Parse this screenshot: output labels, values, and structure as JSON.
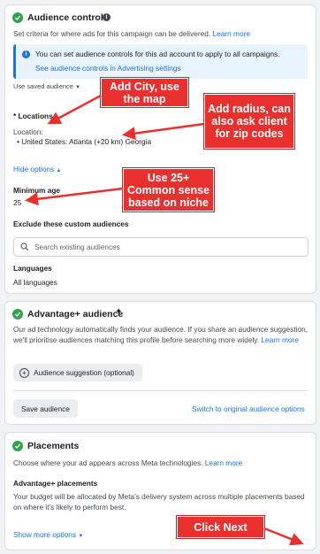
{
  "audience_controls": {
    "title": "Audience controls",
    "description": "Set criteria for where ads for this campaign can be delivered.",
    "learn_more": "Learn more",
    "info_text": "You can set audience controls for this ad account to apply to all campaigns.",
    "info_link": "See audience controls in Advertising settings",
    "saved_audience": "Use saved audience",
    "locations_label": "* Locations",
    "location_sub": "Location:",
    "location_value": "United States: Atlanta (+20 km) Georgia",
    "hide_options": "Hide options",
    "min_age_label": "Minimum age",
    "min_age_value": "25",
    "exclude_label": "Exclude these custom audiences",
    "search_placeholder": "Search existing audiences",
    "languages_label": "Languages",
    "languages_value": "All languages"
  },
  "advantage": {
    "title": "Advantage+ audience",
    "description": "Our ad technology automatically finds your audience. If you share an audience suggestion, we'll prioritise audiences matching this profile before searching more widely.",
    "learn_more": "Learn more",
    "suggestion_button": "Audience suggestion (optional)",
    "save_button": "Save audience",
    "switch_link": "Switch to original audience options"
  },
  "placements": {
    "title": "Placements",
    "description": "Choose where your ad appears across Meta technologies.",
    "learn_more": "Learn more",
    "sub_title": "Advantage+ placements",
    "sub_text": "Your budget will be allocated by Meta's delivery system across multiple placements based on where it's likely to perform best.",
    "show_more": "Show more options"
  },
  "annotations": {
    "city": "Add City, use the map",
    "radius": "Add radius, can also ask client for zip codes",
    "age": "Use 25+ Common sense based on niche",
    "next": "Click Next"
  },
  "colors": {
    "accent": "#1b74e4",
    "success": "#31a24c",
    "annotation": "#e8302e"
  }
}
